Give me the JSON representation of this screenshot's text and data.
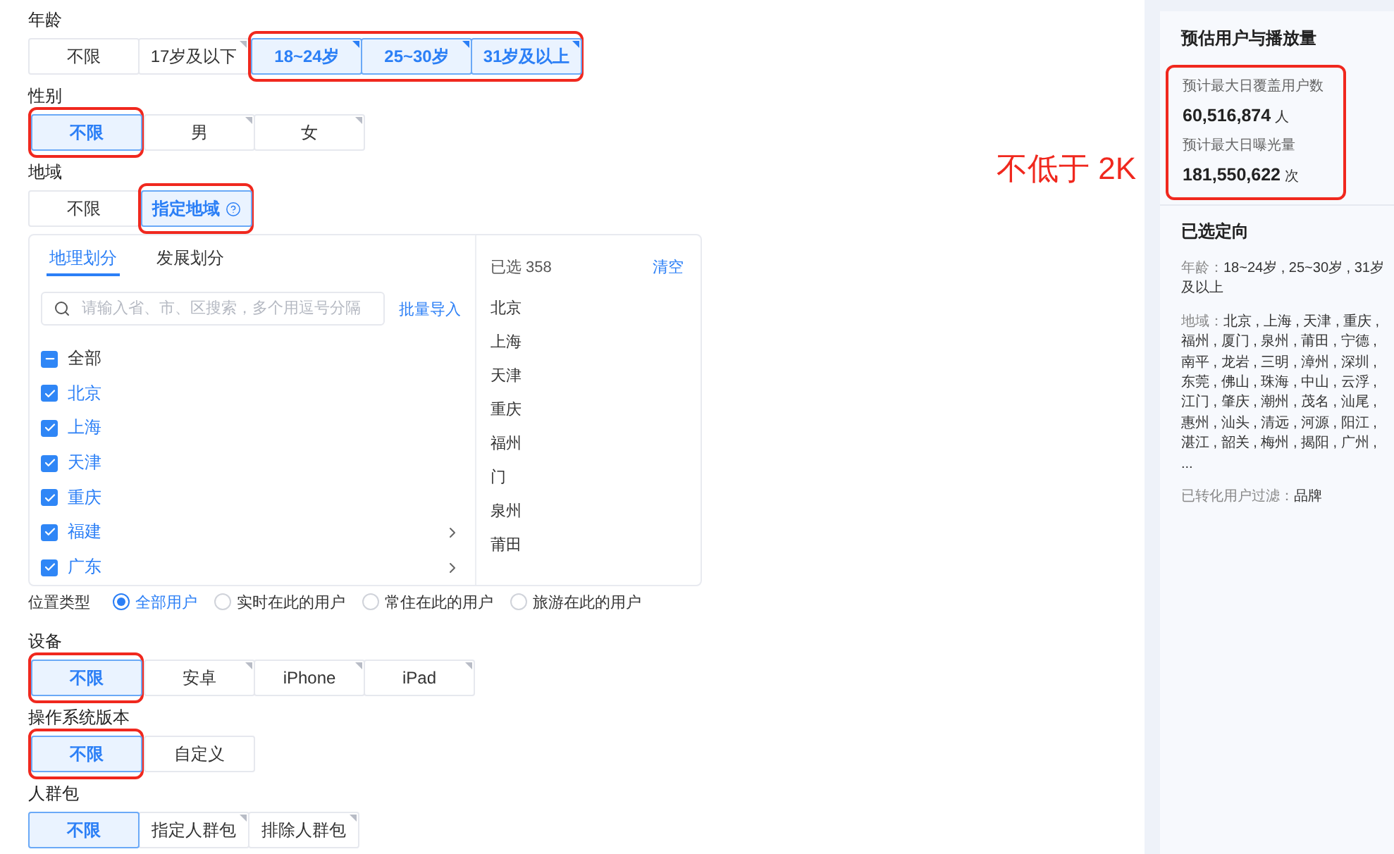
{
  "age": {
    "label": "年龄",
    "options": [
      {
        "label": "不限",
        "selected": false,
        "highlighted": false,
        "corner": false
      },
      {
        "label": "17岁及以下",
        "selected": false,
        "highlighted": false,
        "corner": true
      },
      {
        "label": "18~24岁",
        "selected": true,
        "highlighted": true,
        "corner": true
      },
      {
        "label": "25~30岁",
        "selected": true,
        "highlighted": true,
        "corner": true
      },
      {
        "label": "31岁及以上",
        "selected": true,
        "highlighted": true,
        "corner": true
      }
    ]
  },
  "gender": {
    "label": "性别",
    "options": [
      {
        "label": "不限",
        "selected": true,
        "highlighted": true,
        "corner": false
      },
      {
        "label": "男",
        "selected": false,
        "highlighted": false,
        "corner": true
      },
      {
        "label": "女",
        "selected": false,
        "highlighted": false,
        "corner": true
      }
    ]
  },
  "region": {
    "label": "地域",
    "options": [
      {
        "label": "不限",
        "selected": false,
        "highlighted": false,
        "corner": false
      },
      {
        "label": "指定地域",
        "selected": true,
        "highlighted": true,
        "corner": false,
        "help": true
      }
    ],
    "picker": {
      "tabs": [
        {
          "label": "地理划分",
          "selected": true
        },
        {
          "label": "发展划分",
          "selected": false
        }
      ],
      "search": {
        "placeholder": "请输入省、市、区搜索，多个用逗号分隔"
      },
      "import_link": "批量导入",
      "items": [
        {
          "label": "全部",
          "checked": false,
          "indeterminate": true,
          "expandable": false
        },
        {
          "label": "北京",
          "checked": true,
          "indeterminate": false,
          "expandable": false
        },
        {
          "label": "上海",
          "checked": true,
          "indeterminate": false,
          "expandable": false
        },
        {
          "label": "天津",
          "checked": true,
          "indeterminate": false,
          "expandable": false
        },
        {
          "label": "重庆",
          "checked": true,
          "indeterminate": false,
          "expandable": false
        },
        {
          "label": "福建",
          "checked": true,
          "indeterminate": false,
          "expandable": true
        },
        {
          "label": "广东",
          "checked": true,
          "indeterminate": false,
          "expandable": true
        }
      ],
      "selected_count": "已选 358",
      "clear_link": "清空",
      "selected_items": [
        "北京",
        "上海",
        "天津",
        "重庆",
        "福州",
        "门",
        "泉州",
        "莆田"
      ]
    }
  },
  "location_type": {
    "label": "位置类型",
    "options": [
      {
        "label": "全部用户",
        "selected": true
      },
      {
        "label": "实时在此的用户",
        "selected": false
      },
      {
        "label": "常住在此的用户",
        "selected": false
      },
      {
        "label": "旅游在此的用户",
        "selected": false
      }
    ]
  },
  "device": {
    "label": "设备",
    "options": [
      {
        "label": "不限",
        "selected": true,
        "highlighted": true,
        "corner": false
      },
      {
        "label": "安卓",
        "selected": false,
        "highlighted": false,
        "corner": true
      },
      {
        "label": "iPhone",
        "selected": false,
        "highlighted": false,
        "corner": true
      },
      {
        "label": "iPad",
        "selected": false,
        "highlighted": false,
        "corner": true
      }
    ]
  },
  "os_version": {
    "label": "操作系统版本",
    "options": [
      {
        "label": "不限",
        "selected": true,
        "highlighted": true,
        "corner": false
      },
      {
        "label": "自定义",
        "selected": false,
        "highlighted": false,
        "corner": false
      }
    ]
  },
  "audience": {
    "label": "人群包",
    "options": [
      {
        "label": "不限",
        "selected": true,
        "highlighted": false,
        "corner": false
      },
      {
        "label": "指定人群包",
        "selected": false,
        "highlighted": false,
        "corner": true
      },
      {
        "label": "排除人群包",
        "selected": false,
        "highlighted": false,
        "corner": true
      }
    ]
  },
  "annotation": "不低于 2K",
  "sidebar": {
    "estimate": {
      "title": "预估用户与播放量",
      "highlighted": true,
      "stats": [
        {
          "label": "预计最大日覆盖用户数",
          "value": "60,516,874",
          "unit": "人"
        },
        {
          "label": "预计最大日曝光量",
          "value": "181,550,622",
          "unit": "次"
        }
      ]
    },
    "targeting": {
      "title": "已选定向",
      "entries": [
        {
          "label": "年龄：",
          "value": "18~24岁 , 25~30岁 , 31岁及以上"
        },
        {
          "label": "地域：",
          "value": "北京 , 上海 , 天津 , 重庆 , 福州 , 厦门 , 泉州 , 莆田 , 宁德 , 南平 , 龙岩 , 三明 , 漳州 , 深圳 , 东莞 , 佛山 , 珠海 , 中山 , 云浮 , 江门 , 肇庆 , 潮州 , 茂名 , 汕尾 , 惠州 , 汕头 , 清远 , 河源 , 阳江 , 湛江 , 韶关 , 梅州 , 揭阳 , 广州 , ..."
        },
        {
          "label": "已转化用户过滤：",
          "value": "品牌"
        }
      ]
    }
  }
}
